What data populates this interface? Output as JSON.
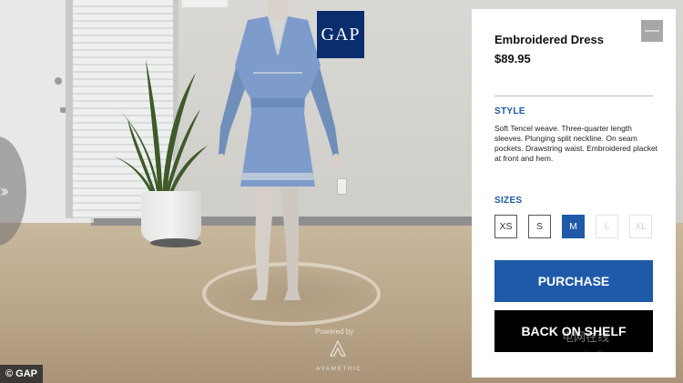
{
  "scene": {
    "brand_logo": "GAP",
    "powered_by": "Powered by",
    "provider": "AVAMETRIC",
    "copyright": "© GAP",
    "watermark": "屯网在线",
    "watermark_sub": "imaijia.com"
  },
  "panel": {
    "title": "Embroidered Dress",
    "price": "$89.95",
    "close_glyph": "—",
    "style_label": "STYLE",
    "description": "Soft Tencel weave. Three-quarter length sleeves. Plunging split neckline. On seam pockets. Drawstring waist. Embroidered placket at front and hem.",
    "sizes_label": "SIZES",
    "sizes": [
      {
        "label": "XS",
        "state": "available"
      },
      {
        "label": "S",
        "state": "available"
      },
      {
        "label": "M",
        "state": "selected"
      },
      {
        "label": "L",
        "state": "unavailable"
      },
      {
        "label": "XL",
        "state": "unavailable"
      }
    ],
    "purchase_label": "PURCHASE",
    "back_label": "BACK ON SHELF"
  },
  "colors": {
    "accent": "#1e5aa8",
    "brand_navy": "#0a2d6e",
    "back_button": "#000000"
  },
  "icons": [
    "close-icon",
    "chevron-right-icon",
    "avametric-logo-icon"
  ]
}
